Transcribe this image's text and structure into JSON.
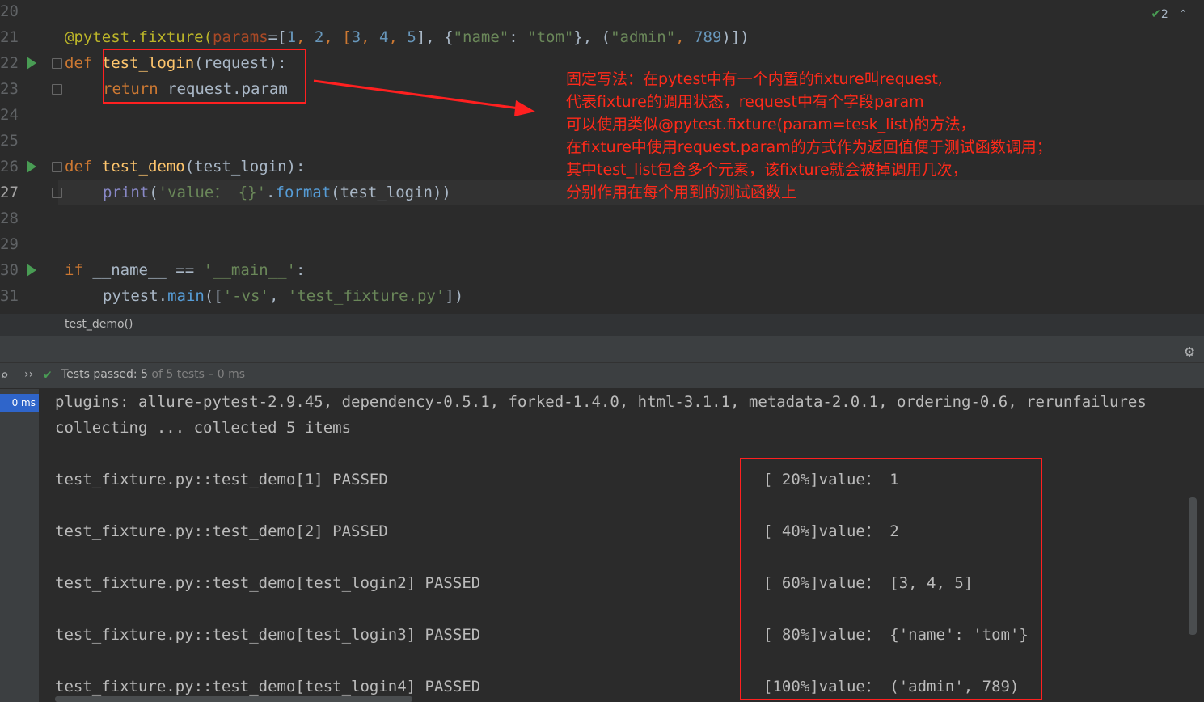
{
  "editor": {
    "line_numbers": [
      "20",
      "21",
      "22",
      "23",
      "24",
      "25",
      "26",
      "27",
      "28",
      "29",
      "30",
      "31"
    ],
    "inspection_count": "2",
    "code": {
      "l21": {
        "decorator": "@pytest.fixture(",
        "param": "params",
        "eq": "=[",
        "n1": "1",
        "c1": ", ",
        "n2": "2",
        "c2": ", [",
        "n3": "3",
        "c3": ", ",
        "n4": "4",
        "c4": ", ",
        "n5": "5",
        "c5": "], {",
        "s1": "\"name\"",
        "c6": ": ",
        "s2": "\"tom\"",
        "c7": "}, (",
        "s3": "\"admin\"",
        "c8": ", ",
        "n6": "789",
        "c9": ")])"
      },
      "l22": {
        "kw": "def ",
        "fn": "test_login",
        "rest": "(request):"
      },
      "l23": {
        "kw": "return ",
        "rest": "request.param"
      },
      "l26": {
        "kw": "def ",
        "fn": "test_demo",
        "rest": "(test_login):"
      },
      "l27": {
        "builtin": "print",
        "p1": "(",
        "s1": "'value： {}'",
        "dot": ".",
        "meth": "format",
        "rest": "(test_login))"
      },
      "l30": {
        "kw": "if ",
        "rest1": "__name__ == ",
        "s1": "'__main__'",
        "rest2": ":"
      },
      "l31": {
        "rest1": "pytest.",
        "meth": "main",
        "rest2": "([",
        "s1": "'-vs'",
        "c1": ", ",
        "s2": "'test_fixture.py'",
        "rest3": "])"
      }
    },
    "annotation": [
      "固定写法：在pytest中有一个内置的fixture叫request,",
      "代表fixture的调用状态，request中有个字段param",
      "可以使用类似@pytest.fixture(param=tesk_list)的方法，",
      "在fixture中使用request.param的方式作为返回值便于测试函数调用；",
      "其中test_list包含多个元素，该fixture就会被掉调用几次，",
      "分别作用在每个用到的测试函数上"
    ]
  },
  "breadcrumb": "test_demo()",
  "run": {
    "status_prefix": "Tests passed: ",
    "status_count": "5",
    "status_suffix": " of 5 tests – 0 ms",
    "duration": "0 ms",
    "console": {
      "plugins": "plugins: allure-pytest-2.9.45, dependency-0.5.1, forked-1.4.0, html-3.1.1, metadata-2.0.1, ordering-0.6, rerunfailures",
      "collecting": "collecting ... collected 5 items",
      "tests": [
        {
          "name": "test_fixture.py::test_demo[1] PASSED",
          "result": "[ 20%]value： 1"
        },
        {
          "name": "test_fixture.py::test_demo[2] PASSED",
          "result": "[ 40%]value： 2"
        },
        {
          "name": "test_fixture.py::test_demo[test_login2] PASSED",
          "result": "[ 60%]value： [3, 4, 5]"
        },
        {
          "name": "test_fixture.py::test_demo[test_login3] PASSED",
          "result": "[ 80%]value： {'name': 'tom'}"
        },
        {
          "name": "test_fixture.py::test_demo[test_login4] PASSED",
          "result": "[100%]value： ('admin', 789)"
        }
      ]
    }
  },
  "colors": {
    "pass_green": "#499c54",
    "annotation_red": "#ff2a1a",
    "selection_blue": "#2f65ca"
  }
}
